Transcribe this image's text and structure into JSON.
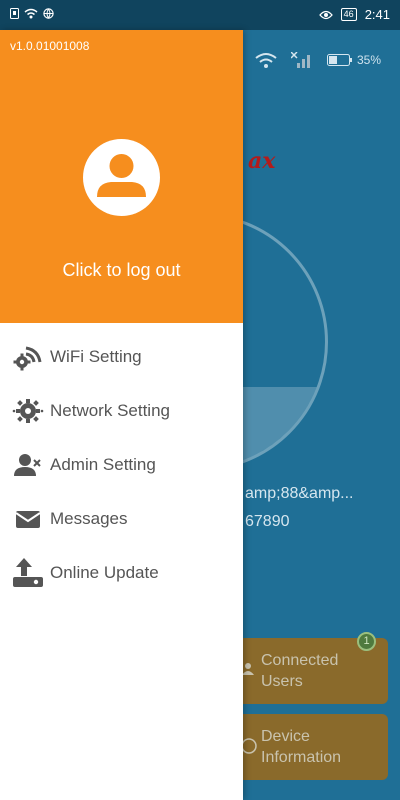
{
  "status_bar": {
    "time": "2:41",
    "battery_level": "46",
    "left_icons": [
      "sim-icon",
      "wifi-icon",
      "globe-icon"
    ],
    "right_icons": [
      "eye-icon",
      "battery-icon"
    ]
  },
  "background": {
    "battery_percent": "35%",
    "ssid_text": "amp;88&amp...",
    "password_text": "67890",
    "card_connected_users": "Connected Users",
    "connected_users_count": "1",
    "card_device_information": "Device Information"
  },
  "drawer": {
    "version": "v1.0.01001008",
    "logout_label": "Click to log out",
    "header_color": "#f68e1e",
    "menu": [
      {
        "label": "WiFi Setting",
        "icon": "wifi-gear-icon"
      },
      {
        "label": "Network Setting",
        "icon": "network-gear-icon"
      },
      {
        "label": "Admin Setting",
        "icon": "admin-user-icon"
      },
      {
        "label": "Messages",
        "icon": "envelope-icon"
      },
      {
        "label": "Online Update",
        "icon": "upload-icon"
      }
    ]
  }
}
